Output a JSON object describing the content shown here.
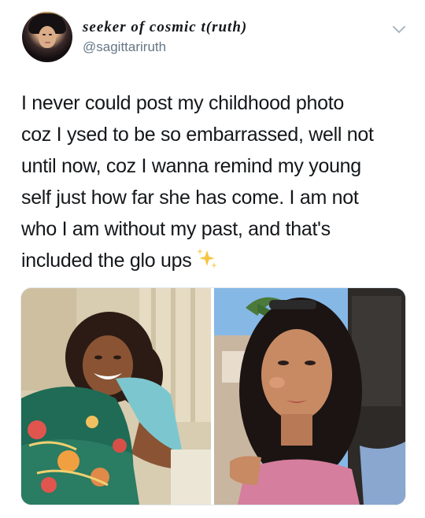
{
  "header": {
    "display_name": "seeker of cosmic t(ruth)",
    "handle": "@sagittariruth",
    "menu_icon": "chevron-down-icon",
    "avatar_icon": "avatar"
  },
  "tweet": {
    "lines": [
      "I never could post my childhood photo",
      "coz I ysed to be so embarrassed, well not",
      "until now, coz I wanna remind my young",
      "self just how far she has come. I am not",
      "who I am without my past, and that's",
      "included the glo ups"
    ],
    "emoji": "sparkles-icon"
  },
  "media": {
    "count": 2,
    "items": [
      "childhood-photo",
      "recent-selfie"
    ]
  },
  "colors": {
    "text": "#14171a",
    "secondary": "#657786",
    "border": "#e1e8ed",
    "sparkle": "#f5c542"
  }
}
